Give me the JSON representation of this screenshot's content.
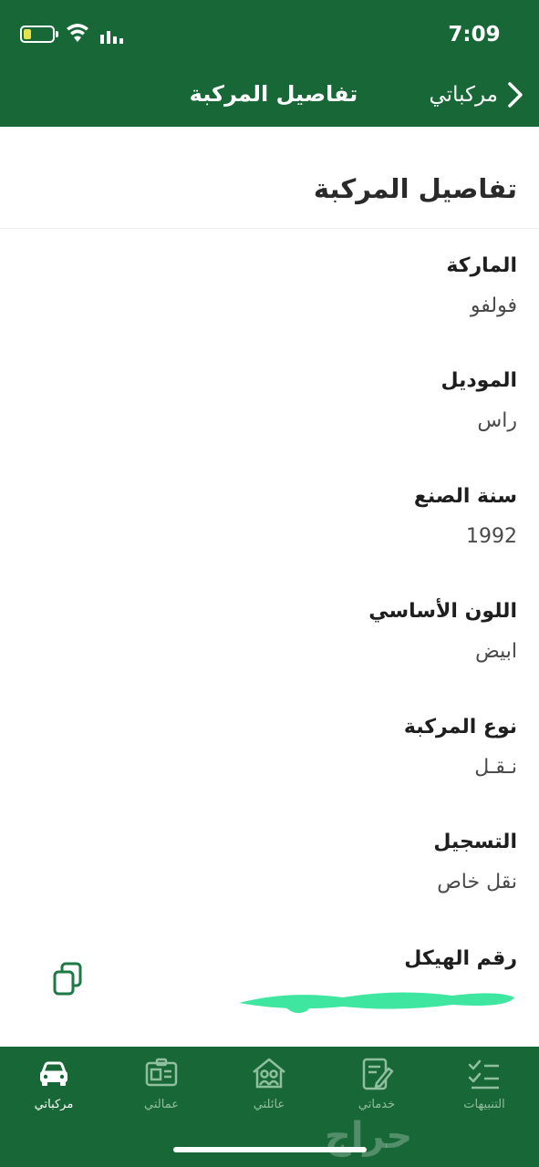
{
  "status_bar": {
    "time": "7:09"
  },
  "nav": {
    "title": "تفاصيل المركبة",
    "back_label": "مركباتي"
  },
  "section": {
    "title": "تفاصيل المركبة"
  },
  "fields": [
    {
      "label": "الماركة",
      "value": "فولفو"
    },
    {
      "label": "الموديل",
      "value": "راس"
    },
    {
      "label": "سنة الصنع",
      "value": "1992"
    },
    {
      "label": "اللون الأساسي",
      "value": "ابيض"
    },
    {
      "label": "نوع المركبة",
      "value": "نـقـل"
    },
    {
      "label": "التسجيل",
      "value": "نقل خاص"
    },
    {
      "label": "رقم الهيكل",
      "value": ""
    }
  ],
  "tabs": [
    {
      "label": "مركباتي",
      "icon": "car-icon",
      "active": true
    },
    {
      "label": "عمالتي",
      "icon": "id-card-icon",
      "active": false
    },
    {
      "label": "عائلتي",
      "icon": "family-home-icon",
      "active": false
    },
    {
      "label": "خدماتي",
      "icon": "edit-document-icon",
      "active": false
    },
    {
      "label": "التنبيهات",
      "icon": "checklist-icon",
      "active": false
    }
  ],
  "watermark": "حراج",
  "colors": {
    "brand_green": "#186837",
    "inactive_tab": "#8fbf9f",
    "redaction": "#3ee6a0"
  }
}
